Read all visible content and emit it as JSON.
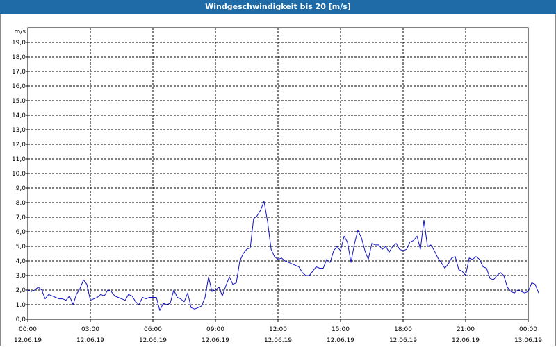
{
  "window": {
    "title": "Windgeschwindigkeit bis 20 [m/s]"
  },
  "colors": {
    "titlebar": "#1e6ba8",
    "line": "#1010c8",
    "grid": "#000000"
  },
  "chart_data": {
    "type": "line",
    "title": "Windgeschwindigkeit bis 20 [m/s]",
    "unit_label": "m/s",
    "grid": true,
    "grid_style": "dashed",
    "ylim": [
      0,
      20
    ],
    "yticks": [
      "0,0",
      "1,0",
      "2,0",
      "3,0",
      "4,0",
      "5,0",
      "6,0",
      "7,0",
      "8,0",
      "9,0",
      "10,0",
      "11,0",
      "12,0",
      "13,0",
      "14,0",
      "15,0",
      "16,0",
      "17,0",
      "18,0",
      "19,0"
    ],
    "xlim_hours": [
      0,
      24
    ],
    "xticks": [
      {
        "hour": 0,
        "time": "00:00",
        "date": "12.06.19"
      },
      {
        "hour": 3,
        "time": "03:00",
        "date": "12.06.19"
      },
      {
        "hour": 6,
        "time": "06:00",
        "date": "12.06.19"
      },
      {
        "hour": 9,
        "time": "09:00",
        "date": "12.06.19"
      },
      {
        "hour": 12,
        "time": "12:00",
        "date": "12.06.19"
      },
      {
        "hour": 15,
        "time": "15:00",
        "date": "12.06.19"
      },
      {
        "hour": 18,
        "time": "18:00",
        "date": "12.06.19"
      },
      {
        "hour": 21,
        "time": "21:00",
        "date": "12.06.19"
      },
      {
        "hour": 24,
        "time": "00:00",
        "date": "13.06.19"
      }
    ],
    "series": [
      {
        "values": [
          [
            0.0,
            2.0
          ],
          [
            0.17,
            1.9
          ],
          [
            0.33,
            2.0
          ],
          [
            0.5,
            2.2
          ],
          [
            0.67,
            2.0
          ],
          [
            0.83,
            1.4
          ],
          [
            1.0,
            1.7
          ],
          [
            1.17,
            1.6
          ],
          [
            1.33,
            1.5
          ],
          [
            1.5,
            1.4
          ],
          [
            1.67,
            1.4
          ],
          [
            1.83,
            1.3
          ],
          [
            2.0,
            1.6
          ],
          [
            2.17,
            1.0
          ],
          [
            2.33,
            1.7
          ],
          [
            2.5,
            2.1
          ],
          [
            2.67,
            2.7
          ],
          [
            2.83,
            2.4
          ],
          [
            3.0,
            1.3
          ],
          [
            3.17,
            1.4
          ],
          [
            3.33,
            1.5
          ],
          [
            3.5,
            1.7
          ],
          [
            3.67,
            1.6
          ],
          [
            3.83,
            2.0
          ],
          [
            4.0,
            1.9
          ],
          [
            4.17,
            1.6
          ],
          [
            4.33,
            1.5
          ],
          [
            4.5,
            1.4
          ],
          [
            4.67,
            1.3
          ],
          [
            4.83,
            1.7
          ],
          [
            5.0,
            1.6
          ],
          [
            5.17,
            1.2
          ],
          [
            5.33,
            1.0
          ],
          [
            5.5,
            1.5
          ],
          [
            5.67,
            1.4
          ],
          [
            5.83,
            1.5
          ],
          [
            6.0,
            1.5
          ],
          [
            6.17,
            1.5
          ],
          [
            6.33,
            0.6
          ],
          [
            6.5,
            1.1
          ],
          [
            6.67,
            1.0
          ],
          [
            6.83,
            1.1
          ],
          [
            7.0,
            2.0
          ],
          [
            7.17,
            1.5
          ],
          [
            7.33,
            1.4
          ],
          [
            7.5,
            1.2
          ],
          [
            7.67,
            1.8
          ],
          [
            7.83,
            0.8
          ],
          [
            8.0,
            0.7
          ],
          [
            8.17,
            0.8
          ],
          [
            8.33,
            0.9
          ],
          [
            8.5,
            1.5
          ],
          [
            8.67,
            2.9
          ],
          [
            8.83,
            1.9
          ],
          [
            9.0,
            2.0
          ],
          [
            9.17,
            2.2
          ],
          [
            9.33,
            1.6
          ],
          [
            9.5,
            2.3
          ],
          [
            9.67,
            2.9
          ],
          [
            9.83,
            2.4
          ],
          [
            10.0,
            2.5
          ],
          [
            10.17,
            4.0
          ],
          [
            10.33,
            4.5
          ],
          [
            10.5,
            4.8
          ],
          [
            10.67,
            4.9
          ],
          [
            10.83,
            6.9
          ],
          [
            11.0,
            7.1
          ],
          [
            11.17,
            7.5
          ],
          [
            11.33,
            8.1
          ],
          [
            11.5,
            6.7
          ],
          [
            11.67,
            4.8
          ],
          [
            11.83,
            4.3
          ],
          [
            12.0,
            4.1
          ],
          [
            12.17,
            4.2
          ],
          [
            12.33,
            4.0
          ],
          [
            12.5,
            3.9
          ],
          [
            12.67,
            3.8
          ],
          [
            12.83,
            3.7
          ],
          [
            13.0,
            3.6
          ],
          [
            13.17,
            3.2
          ],
          [
            13.33,
            3.0
          ],
          [
            13.5,
            3.0
          ],
          [
            13.67,
            3.3
          ],
          [
            13.83,
            3.6
          ],
          [
            14.0,
            3.5
          ],
          [
            14.17,
            3.5
          ],
          [
            14.33,
            4.1
          ],
          [
            14.5,
            3.9
          ],
          [
            14.67,
            4.7
          ],
          [
            14.83,
            5.0
          ],
          [
            15.0,
            4.7
          ],
          [
            15.17,
            5.7
          ],
          [
            15.33,
            5.3
          ],
          [
            15.5,
            3.9
          ],
          [
            15.67,
            5.2
          ],
          [
            15.83,
            6.1
          ],
          [
            16.0,
            5.6
          ],
          [
            16.17,
            4.7
          ],
          [
            16.33,
            4.1
          ],
          [
            16.5,
            5.2
          ],
          [
            16.67,
            5.1
          ],
          [
            16.83,
            5.1
          ],
          [
            17.0,
            4.8
          ],
          [
            17.17,
            5.0
          ],
          [
            17.33,
            4.6
          ],
          [
            17.5,
            5.0
          ],
          [
            17.67,
            5.2
          ],
          [
            17.83,
            4.8
          ],
          [
            18.0,
            4.7
          ],
          [
            18.17,
            4.8
          ],
          [
            18.33,
            5.3
          ],
          [
            18.5,
            5.4
          ],
          [
            18.67,
            5.7
          ],
          [
            18.83,
            4.8
          ],
          [
            19.0,
            6.8
          ],
          [
            19.17,
            5.0
          ],
          [
            19.33,
            5.1
          ],
          [
            19.5,
            4.7
          ],
          [
            19.67,
            4.2
          ],
          [
            19.83,
            3.9
          ],
          [
            20.0,
            3.5
          ],
          [
            20.17,
            3.8
          ],
          [
            20.33,
            4.2
          ],
          [
            20.5,
            4.3
          ],
          [
            20.67,
            3.4
          ],
          [
            20.83,
            3.3
          ],
          [
            21.0,
            3.0
          ],
          [
            21.17,
            4.2
          ],
          [
            21.33,
            4.1
          ],
          [
            21.5,
            4.3
          ],
          [
            21.67,
            4.1
          ],
          [
            21.83,
            3.6
          ],
          [
            22.0,
            3.5
          ],
          [
            22.17,
            2.8
          ],
          [
            22.33,
            2.7
          ],
          [
            22.5,
            3.0
          ],
          [
            22.67,
            3.2
          ],
          [
            22.83,
            3.0
          ],
          [
            23.0,
            2.2
          ],
          [
            23.17,
            1.9
          ],
          [
            23.33,
            1.8
          ],
          [
            23.5,
            2.0
          ],
          [
            23.67,
            1.9
          ],
          [
            23.83,
            1.8
          ],
          [
            24.0,
            1.9
          ],
          [
            24.17,
            2.5
          ],
          [
            24.33,
            2.4
          ],
          [
            24.5,
            1.8
          ]
        ]
      }
    ]
  }
}
